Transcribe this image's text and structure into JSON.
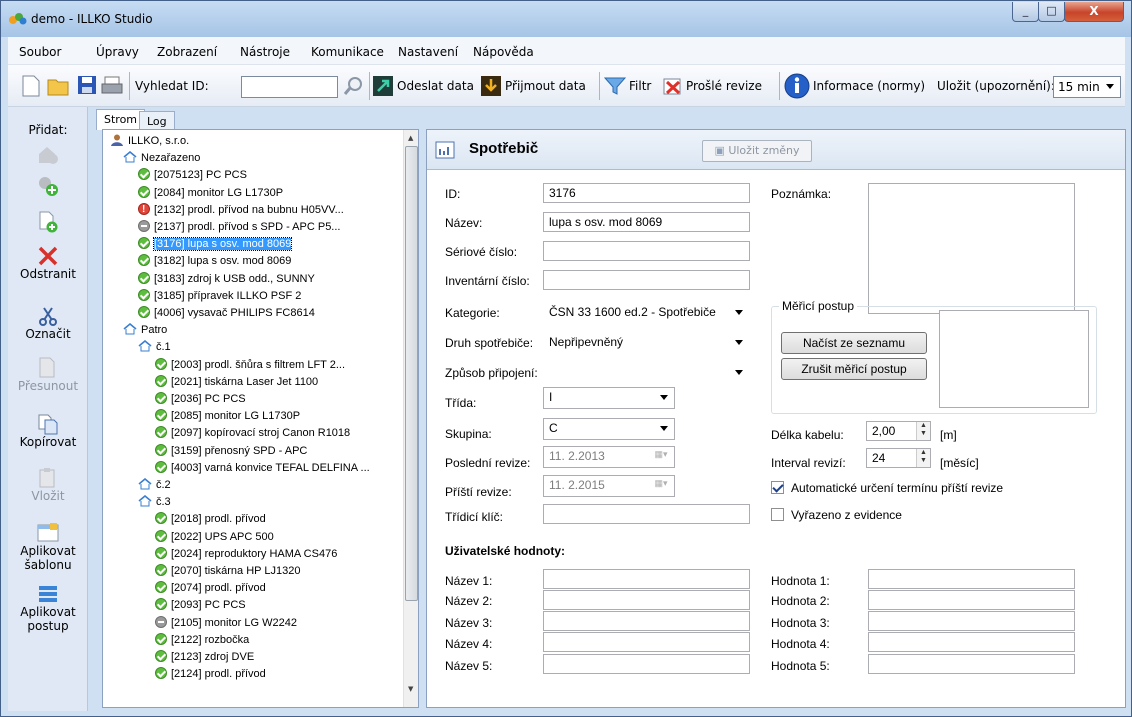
{
  "window": {
    "title": "demo - ILLKO Studio",
    "minimize": "_",
    "maximize": "□",
    "close": "X"
  },
  "menu": [
    "Soubor",
    "Úpravy",
    "Zobrazení",
    "Nástroje",
    "Komunikace",
    "Nastavení",
    "Nápověda"
  ],
  "toolbar": {
    "search_label": "Vyhledat ID:",
    "search_value": "",
    "send": "Odeslat data",
    "receive": "Přijmout data",
    "filter": "Filtr",
    "expired": "Prošlé revize",
    "info": "Informace (normy)",
    "save_label": "Uložit (upozornění):",
    "save_value": "15 min"
  },
  "sidebar": {
    "add": "Přidat:",
    "remove": "Odstranit",
    "mark": "Označit",
    "move": "Přesunout",
    "copy": "Kopírovat",
    "paste": "Vložit",
    "apply_template": [
      "Aplikovat",
      "šablonu"
    ],
    "apply_procedure": [
      "Aplikovat",
      "postup"
    ]
  },
  "tabs": [
    "Strom",
    "Log"
  ],
  "tree": [
    {
      "label": "ILLKO, s.r.o.",
      "icon": "org",
      "level": 0
    },
    {
      "label": "Nezařazeno",
      "icon": "home",
      "level": 1
    },
    {
      "label": "[2075123] PC PCS",
      "icon": "ok",
      "level": 2
    },
    {
      "label": "[2084] monitor LG L1730P",
      "icon": "ok",
      "level": 2
    },
    {
      "label": "[2132] prodl. přívod na bubnu H05VV...",
      "icon": "err",
      "level": 2
    },
    {
      "label": "[2137] prodl. přívod s SPD - APC P5...",
      "icon": "gray",
      "level": 2
    },
    {
      "label": "[3176] lupa s osv. mod 8069",
      "icon": "ok",
      "level": 2,
      "selected": true
    },
    {
      "label": "[3182] lupa s osv. mod 8069",
      "icon": "ok",
      "level": 2
    },
    {
      "label": "[3183] zdroj k USB odd., SUNNY",
      "icon": "ok",
      "level": 2
    },
    {
      "label": "[3185] přípravek ILLKO PSF 2",
      "icon": "ok",
      "level": 2
    },
    {
      "label": "[4006] vysavač PHILIPS FC8614",
      "icon": "ok",
      "level": 2
    },
    {
      "label": "Patro",
      "icon": "home",
      "level": 1
    },
    {
      "label": "č.1",
      "icon": "home",
      "level": 2
    },
    {
      "label": "[2003] prodl. šňůra s filtrem LFT 2...",
      "icon": "ok",
      "level": 3
    },
    {
      "label": "[2021] tiskárna Laser Jet 1100",
      "icon": "ok",
      "level": 3
    },
    {
      "label": "[2036] PC PCS",
      "icon": "ok",
      "level": 3
    },
    {
      "label": "[2085] monitor LG L1730P",
      "icon": "ok",
      "level": 3
    },
    {
      "label": "[2097] kopírovací stroj Canon R1018",
      "icon": "ok",
      "level": 3
    },
    {
      "label": "[3159] přenosný SPD - APC",
      "icon": "ok",
      "level": 3
    },
    {
      "label": "[4003] varná konvice TEFAL DELFINA ...",
      "icon": "ok",
      "level": 3
    },
    {
      "label": "č.2",
      "icon": "home",
      "level": 2
    },
    {
      "label": "č.3",
      "icon": "home",
      "level": 2
    },
    {
      "label": "[2018] prodl. přívod",
      "icon": "ok",
      "level": 3
    },
    {
      "label": "[2022] UPS APC 500",
      "icon": "ok",
      "level": 3
    },
    {
      "label": "[2024] reproduktory HAMA CS476",
      "icon": "ok",
      "level": 3
    },
    {
      "label": "[2070] tiskárna HP LJ1320",
      "icon": "ok",
      "level": 3
    },
    {
      "label": "[2074] prodl. přívod",
      "icon": "ok",
      "level": 3
    },
    {
      "label": "[2093] PC PCS",
      "icon": "ok",
      "level": 3
    },
    {
      "label": "[2105] monitor LG W2242",
      "icon": "gray",
      "level": 3
    },
    {
      "label": "[2122] rozbočka",
      "icon": "ok",
      "level": 3
    },
    {
      "label": "[2123] zdroj DVE",
      "icon": "ok",
      "level": 3
    },
    {
      "label": "[2124] prodl. přívod",
      "icon": "ok",
      "level": 3
    }
  ],
  "detail": {
    "title": "Spotřebič",
    "save_button": "Uložit změny",
    "fields": {
      "id_label": "ID:",
      "id": "3176",
      "name_label": "Název:",
      "name": "lupa s osv. mod 8069",
      "serial_label": "Sériové číslo:",
      "serial": "",
      "inventory_label": "Inventární číslo:",
      "inventory": "",
      "category_label": "Kategorie:",
      "category": "ČSN 33 1600 ed.2 - Spotřebiče",
      "type_label": "Druh spotřebiče:",
      "type": "Nepřipevněný",
      "connection_label": "Způsob připojení:",
      "connection": "",
      "class_label": "Třída:",
      "class": "I",
      "group_label": "Skupina:",
      "group": "C",
      "last_label": "Poslední revize:",
      "last": "11.  2.2013",
      "next_label": "Příští revize:",
      "next": "11.  2.2015",
      "sort_label": "Třídicí klíč:",
      "sort": ""
    },
    "note_label": "Poznámka:",
    "note": "",
    "procedure": {
      "legend": "Měřicí postup",
      "load": "Načíst ze seznamu",
      "cancel": "Zrušit měřicí postup"
    },
    "cable_label": "Délka kabelu:",
    "cable": "2,00",
    "cable_unit": "[m]",
    "interval_label": "Interval revizí:",
    "interval": "24",
    "interval_unit": "[měsíc]",
    "auto_label": "Automatické určení termínu příští revize",
    "auto_checked": true,
    "retired_label": "Vyřazeno z evidence",
    "retired_checked": false,
    "user_title": "Uživatelské hodnoty:",
    "user_names": [
      "Název 1:",
      "Název 2:",
      "Název 3:",
      "Název 4:",
      "Název 5:"
    ],
    "user_values": [
      "Hodnota 1:",
      "Hodnota 2:",
      "Hodnota 3:",
      "Hodnota 4:",
      "Hodnota 5:"
    ]
  }
}
